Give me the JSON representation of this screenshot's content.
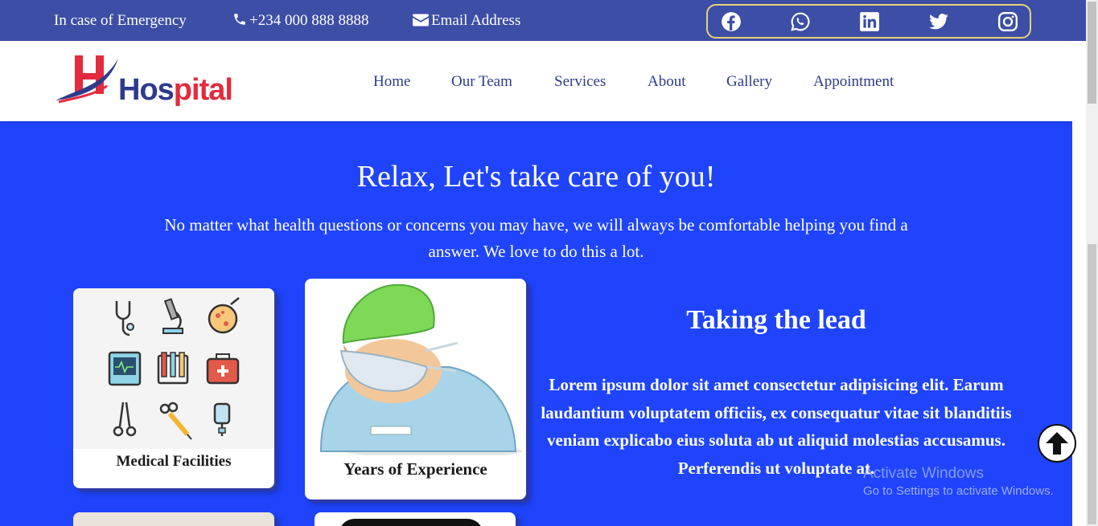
{
  "topbar": {
    "emergency": "In case of Emergency",
    "phone": "+234 000 888 8888",
    "email": "Email Address",
    "social": [
      "facebook-icon",
      "whatsapp-icon",
      "linkedin-icon",
      "twitter-icon",
      "instagram-icon"
    ]
  },
  "logo": {
    "part1": "Hos",
    "part2": "pital"
  },
  "nav": {
    "items": [
      "Home",
      "Our Team",
      "Services",
      "About",
      "Gallery",
      "Appointment"
    ]
  },
  "hero": {
    "title": "Relax, Let's take care of you!",
    "text": "No matter what health questions or concerns you may have, we will always be comfortable helping you find a answer. We love to do this a lot."
  },
  "cards": [
    {
      "caption": "Medical Facilities"
    },
    {
      "caption": "Years of Experience"
    }
  ],
  "lead": {
    "title": "Taking the lead",
    "text": "Lorem ipsum dolor sit amet consectetur adipisicing elit. Earum laudantium voluptatem officiis, ex consequatur vitae sit blanditiis veniam explicabo eius soluta ab ut aliquid molestias accusamus. Perferendis ut voluptate at."
  },
  "watermark": {
    "line1": "Activate Windows",
    "line2": "Go to Settings to activate Windows."
  },
  "colors": {
    "topbar": "#3d4ea6",
    "hero": "#1f44fb",
    "nav_text": "#2e3a8c",
    "logo_red": "#e32b3d"
  }
}
